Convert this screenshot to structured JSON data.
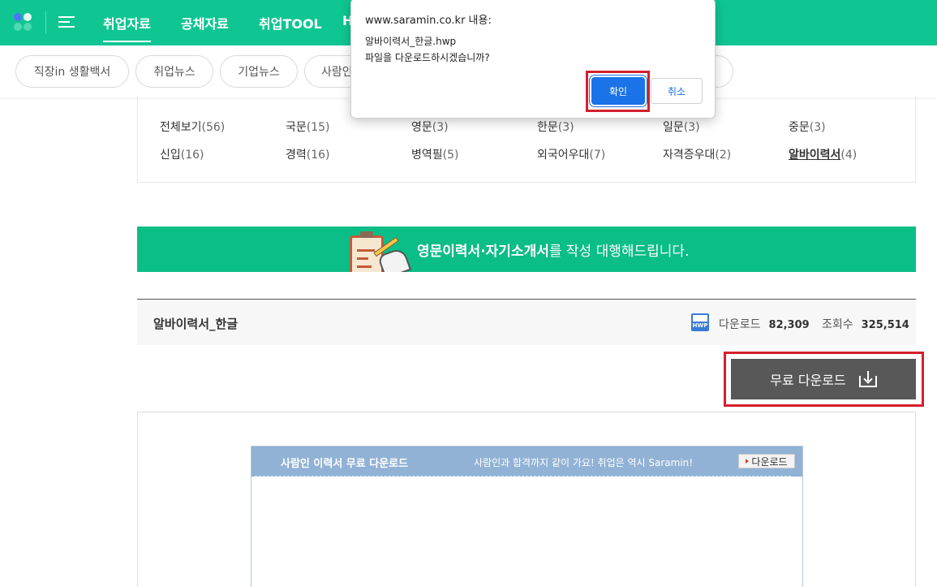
{
  "topnav": {
    "items": [
      "취업자료",
      "공채자료",
      "취업TOOL",
      "H"
    ]
  },
  "subnav": {
    "pills": [
      "직장in 생활백서",
      "취업뉴스",
      "기업뉴스",
      "사람인"
    ]
  },
  "categories": [
    {
      "label": "전체보기",
      "count": "(56)"
    },
    {
      "label": "국문",
      "count": "(15)"
    },
    {
      "label": "영문",
      "count": "(3)"
    },
    {
      "label": "한문",
      "count": "(3)"
    },
    {
      "label": "일문",
      "count": "(3)"
    },
    {
      "label": "중문",
      "count": "(3)"
    },
    {
      "label": "신입",
      "count": "(16)"
    },
    {
      "label": "경력",
      "count": "(16)"
    },
    {
      "label": "병역필",
      "count": "(5)"
    },
    {
      "label": "외국어우대",
      "count": "(7)"
    },
    {
      "label": "자격증우대",
      "count": "(2)"
    },
    {
      "label": "알바이력서",
      "count": "(4)"
    }
  ],
  "banner": {
    "bold": "영문이력서·자기소개서",
    "rest": "를 작성 대행해드립니다."
  },
  "file": {
    "name": "알바이력서_한글",
    "icon_text": "HWP",
    "download_label": "다운로드",
    "download_count": "82,309",
    "views_label": "조회수",
    "views_count": "325,514"
  },
  "download_button": {
    "label": "무료 다운로드"
  },
  "preview": {
    "title": "사람인 이력서 무료 다운로드",
    "tagline": "사람인과 합격까지 같이 가요! 취업은 역시 Saramin!",
    "button": "다운로드"
  },
  "dialog": {
    "origin": "www.saramin.co.kr 내용:",
    "filename": "알바이력서_한글.hwp",
    "message": "파일을 다운로드하시겠습니까?",
    "ok": "확인",
    "cancel": "취소"
  },
  "colors": {
    "brand_green": "#0fc693",
    "banner_green": "#0bbd86",
    "highlight_red": "#d4202c",
    "dialog_blue": "#1a73e8"
  }
}
